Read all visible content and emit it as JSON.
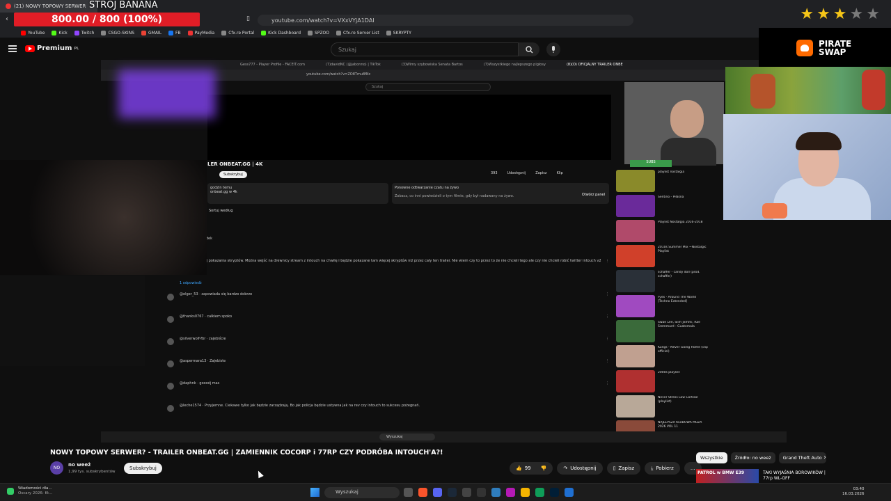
{
  "browser": {
    "tab_title": "(21) NOWY TOPOWY SERWER",
    "url": "youtube.com/watch?v=VXxVYjA1DAI",
    "bookmarks": [
      "YouTube",
      "Kick",
      "Twitch",
      "CSGO-SKINS",
      "GMAIL",
      "FB",
      "PayMedia",
      "Cfx.re Portal",
      "Kick Dashboard",
      "SPZOO",
      "Cfx.re Server List",
      "SKRYPTY"
    ]
  },
  "overlay": {
    "stream_title": "STRÓJ BANANA",
    "goal_text": "800.00 / 800 (100%)",
    "goal_progress": 1.0,
    "stars_on": 3,
    "stars_total": 5,
    "sponsor_line1": "PIRATE",
    "sponsor_line2": "SWAP"
  },
  "youtube": {
    "logo_text": "Premium",
    "logo_region": "PL",
    "search_placeholder": "Szukaj"
  },
  "inner": {
    "tabs": [
      "Gess777 - Player Profile - FACEIT.com",
      "(7)davidNC (@jabonno) | TikTok",
      "(3)Wimy szybowiska Senata Bartos",
      "(7)Wszystkiego najlepszego pigłosy",
      "(8)(O) OFICJALNY TRAILER ONBE"
    ],
    "url": "youtube.com/watch?v=ZO8Tmu8fNc",
    "search": "Szukaj",
    "title": "LER ONBEAT.GG | 4K",
    "subscribe": "Subskrybuj",
    "actions": [
      "393",
      "Udostępnij",
      "Zapisz",
      "Klip"
    ],
    "desc_line1": "godzin temu",
    "desc_line2": "onbeat.gg w 4k",
    "live_title": "Ponowne odtwarzanie czatu na żywo",
    "live_text": "Zobacz, co inni powiedzieli o tym filmie, gdy był nadawany na żywo.",
    "live_btn": "Otwórz panel",
    "sort": "Sortuj według",
    "comments": [
      "zobaczyć wypadek",
      "mamski i wiecej pokazania skryptów. Można wejść na drewnicy stream z intouch na chwilę i będzie pokazane tam więcej skryptów niż przez cały ten trailer. Nie wiem czy to przez to że nie chcieli tego ale czy nie chcieli robić twitter intouch v2",
      "1 odpowiedź",
      "@elger_53 · zapowiada się bardzo dobrze",
      "@thanks0767 · całkiem spoko",
      "@silverwolf-fbr · zajebiście",
      "@aspermara13 · Zajebiste",
      "@daphnk · goooój mas",
      "@leche1574 · Przyjemne. Ciekawe tylko jak będzie zarządzają. Bo jak policja będzie ustywna jak na rev czy intouch to sukcesu pożegnań."
    ],
    "sidebar": [
      "playlist nostalgia",
      "Sentino - Piłaśna",
      "Playlist Nostalgia 2016-2018",
      "2010s Summer Mix ~Nostalgic Playlist",
      "schaffer - candy doll (prod. schaffer)",
      "Fyex - Around The World [Techno Extended]",
      "Swae Lee, Slim Jxmmi, Rae Sremmurd - Guatemala",
      "Kungs - Never Going Home (clip officiel)",
      "2000s playlist",
      "Never Stress Low Cortisol (playlist)",
      "NAJLEPSZA KLUBOWA MUZA 2026 VOL 11"
    ],
    "subs_label": "SUBS",
    "taskbar_search": "Wyszukaj"
  },
  "video": {
    "title": "NOWY TOPOWY SERWER? - TRAILER ONBEAT.GG | ZAMIENNIK COCORP i 77RP CZY PODRÓBA INTOUCH'A?!",
    "channel_avatar": "NO",
    "channel": "no weeż",
    "subscribers": "1,99 tys. subskrybentów",
    "subscribe": "Subskrybuj",
    "likes": "99",
    "share": "Udostępnij",
    "save": "Zapisz",
    "download": "Pobierz",
    "more": "…"
  },
  "chips": [
    "Wszystkie",
    "Źródło: no weeż",
    "Grand Theft Auto"
  ],
  "upnext": {
    "thumb_text": "PATROL w BMW E39",
    "title": "TAKI WYJAŚNIA BOROWIKÓW | 77rp WL-OFF"
  },
  "taskbar": {
    "news_title": "Wiadomości dla...",
    "news_sub": "Oscary 2026: Kt...",
    "search": "Wyszukaj",
    "time": "03:40",
    "date": "16.03.2026"
  },
  "colors": {
    "accent_red": "#e11d26",
    "youtube_red": "#ff0000",
    "star": "#f5c518"
  }
}
